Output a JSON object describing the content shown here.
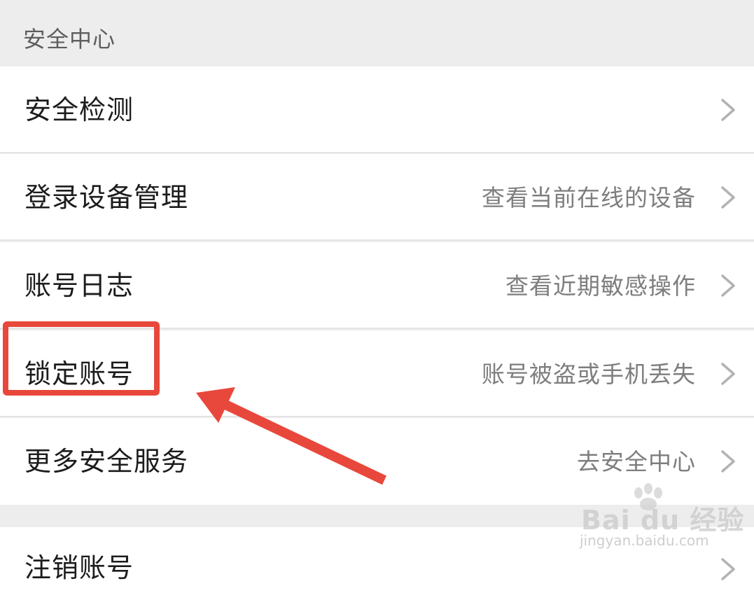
{
  "section": {
    "title": "安全中心"
  },
  "rows": [
    {
      "label": "安全检测",
      "value": ""
    },
    {
      "label": "登录设备管理",
      "value": "查看当前在线的设备"
    },
    {
      "label": "账号日志",
      "value": "查看近期敏感操作"
    },
    {
      "label": "锁定账号",
      "value": "账号被盗或手机丢失"
    },
    {
      "label": "更多安全服务",
      "value": "去安全中心"
    }
  ],
  "bottom_row": {
    "label": "注销账号"
  },
  "annotation": {
    "highlight_color": "#e8483b",
    "highlighted_item": "锁定账号"
  },
  "watermark": {
    "logo": "Bai du 经验",
    "url": "jingyan.baidu.com"
  },
  "icons": {
    "row_chevron": "chevron-right-icon"
  }
}
